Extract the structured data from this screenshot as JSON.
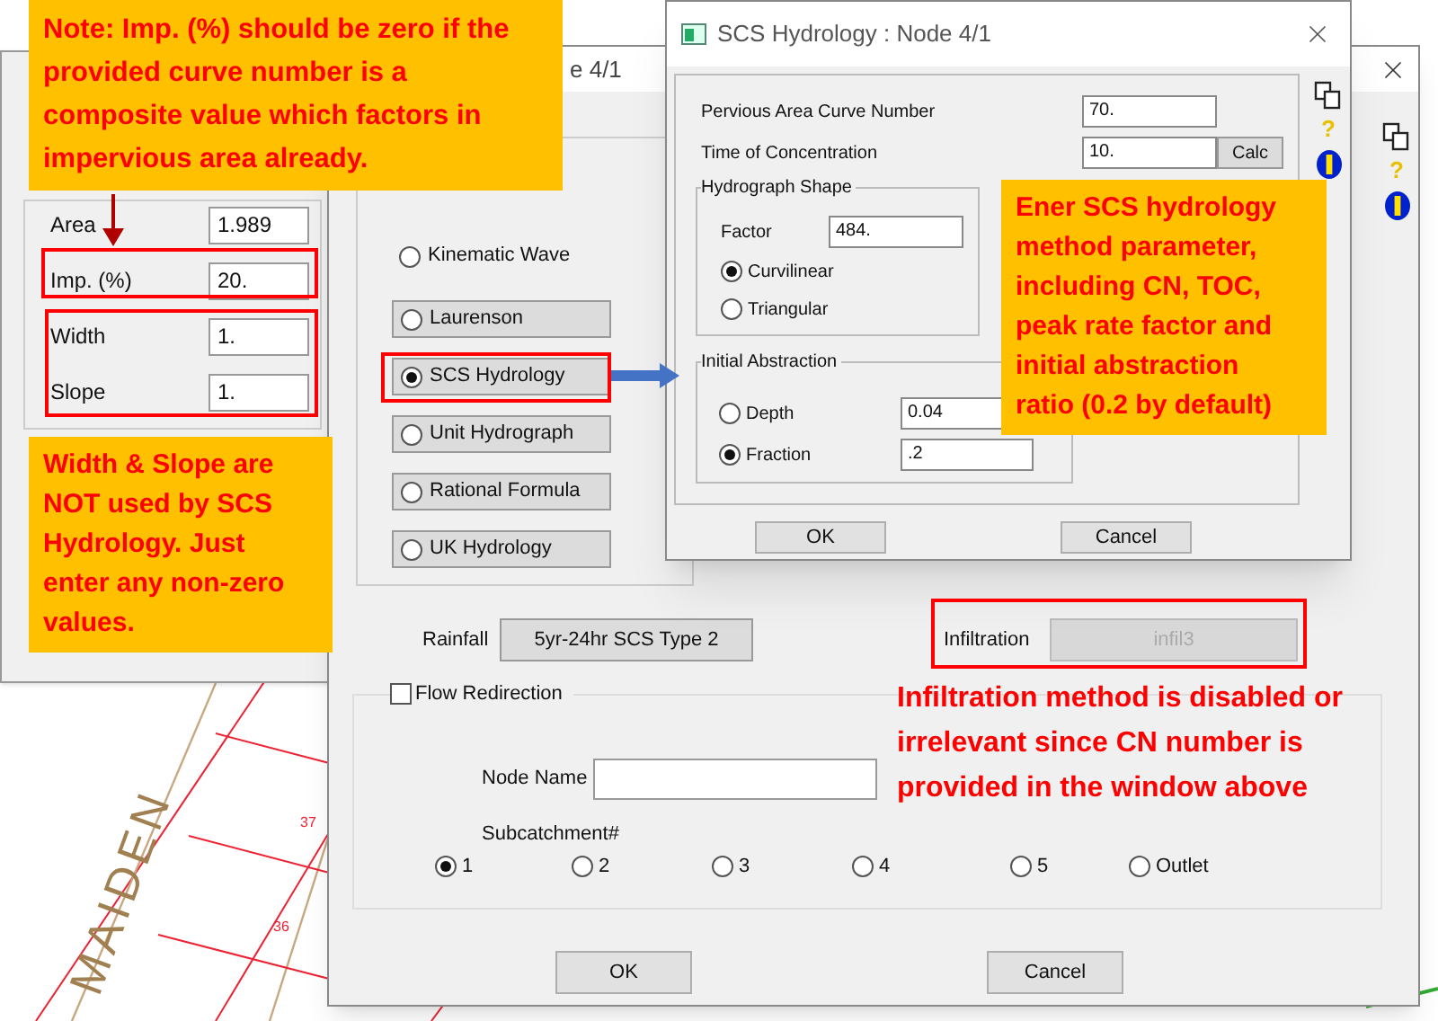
{
  "map": {
    "street_label": "MAIDEN",
    "lot_numbers": [
      "37",
      "36"
    ]
  },
  "subcatchment_window": {
    "fields": [
      {
        "label": "Area",
        "value": "1.989"
      },
      {
        "label": "Imp. (%)",
        "value": "20."
      },
      {
        "label": "Width",
        "value": "1."
      },
      {
        "label": "Slope",
        "value": "1."
      }
    ]
  },
  "main_dialog": {
    "title_fragment": "e 4/1",
    "help_mark": "?",
    "methods": [
      {
        "label": "Kinematic Wave",
        "kind": "radio",
        "selected": false
      },
      {
        "label": "Laurenson",
        "kind": "radio_button",
        "selected": false
      },
      {
        "label": "SCS Hydrology",
        "kind": "radio_button",
        "selected": true
      },
      {
        "label": "Unit Hydrograph",
        "kind": "radio_button",
        "selected": false
      },
      {
        "label": "Rational Formula",
        "kind": "radio_button",
        "selected": false
      },
      {
        "label": "UK Hydrology",
        "kind": "radio_button",
        "selected": false
      }
    ],
    "rainfall": {
      "label": "Rainfall",
      "value": "5yr-24hr SCS Type 2"
    },
    "infiltration": {
      "label": "Infiltration",
      "value": "infil3",
      "disabled": true
    },
    "flow_redirection": {
      "label": "Flow Redirection",
      "checked": false,
      "node_name_label": "Node Name",
      "subcatchment_label": "Subcatchment#",
      "subcatchments": [
        {
          "label": "1",
          "selected": true
        },
        {
          "label": "2",
          "selected": false
        },
        {
          "label": "3",
          "selected": false
        },
        {
          "label": "4",
          "selected": false
        },
        {
          "label": "5",
          "selected": false
        },
        {
          "label": "Outlet",
          "selected": false
        }
      ]
    },
    "buttons": [
      "OK",
      "Cancel"
    ]
  },
  "scs_dialog": {
    "title": "SCS Hydrology : Node 4/1",
    "help_mark": "?",
    "fields": [
      {
        "label": "Pervious Area Curve Number",
        "value": "70."
      },
      {
        "label": "Time of Concentration",
        "value": "10.",
        "action": "Calc"
      }
    ],
    "hydrograph_shape": {
      "title": "Hydrograph Shape",
      "factor_label": "Factor",
      "factor_value": "484.",
      "options": [
        {
          "label": "Curvilinear",
          "selected": true
        },
        {
          "label": "Triangular",
          "selected": false
        }
      ]
    },
    "initial_abstraction": {
      "title": "Initial Abstraction",
      "options": [
        {
          "label": "Depth",
          "value": "0.04",
          "selected": false
        },
        {
          "label": "Fraction",
          "value": ".2",
          "selected": true
        }
      ]
    },
    "buttons": [
      "OK",
      "Cancel"
    ]
  },
  "annotations": [
    {
      "kind": "callout",
      "text": "Note: Imp. (%) should be zero if the provided curve number is a composite value which factors in impervious area already."
    },
    {
      "kind": "callout",
      "text": "Width & Slope are NOT used by SCS Hydrology. Just enter any non-zero values."
    },
    {
      "kind": "callout",
      "text": "Ener SCS hydrology method parameter, including CN, TOC, peak rate factor and initial abstraction ratio (0.2 by default)"
    },
    {
      "kind": "plain",
      "text": "Infiltration method is disabled or irrelevant since CN number is provided in the window above"
    }
  ]
}
